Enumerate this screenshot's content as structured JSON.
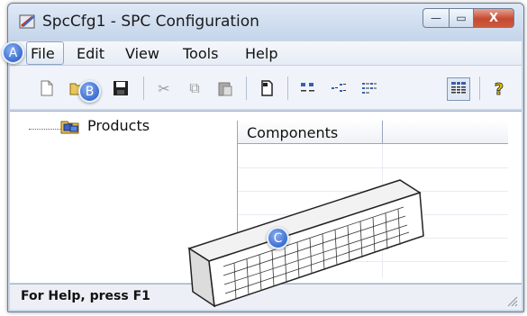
{
  "window": {
    "title": "SpcCfg1 - SPC Configuration"
  },
  "menubar": {
    "items": [
      "File",
      "Edit",
      "View",
      "Tools",
      "Help"
    ]
  },
  "tree": {
    "root_label": "Products"
  },
  "list": {
    "columns": [
      "Components",
      ""
    ]
  },
  "status": {
    "text": "For Help, press F1"
  },
  "callouts": {
    "a": "A",
    "b": "B",
    "c": "C"
  },
  "window_buttons": {
    "minimize": "—",
    "maximize": "▭",
    "close": "X"
  },
  "icons": [
    "app-icon",
    "new-icon",
    "open-icon",
    "save-icon",
    "cut-icon",
    "copy-icon",
    "paste-icon",
    "document-icon",
    "large-icons-icon",
    "small-icons-icon",
    "list-view-icon",
    "details-view-icon",
    "help-icon",
    "tree-folder-icon",
    "keyboard-icon",
    "resize-grip-icon"
  ],
  "colors": {
    "callout": "#3c6ed0",
    "close_button": "#c44a31",
    "help_icon": "#e6c200"
  }
}
